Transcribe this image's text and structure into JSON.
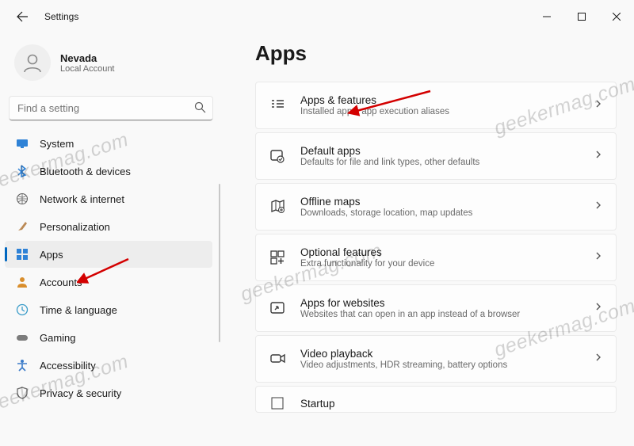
{
  "window": {
    "title": "Settings",
    "user": {
      "name": "Nevada",
      "subtitle": "Local Account"
    },
    "search_placeholder": "Find a setting"
  },
  "nav": {
    "selected_index": 4,
    "items": [
      {
        "label": "System",
        "icon": "display"
      },
      {
        "label": "Bluetooth & devices",
        "icon": "bluetooth"
      },
      {
        "label": "Network & internet",
        "icon": "network"
      },
      {
        "label": "Personalization",
        "icon": "brush"
      },
      {
        "label": "Apps",
        "icon": "apps"
      },
      {
        "label": "Accounts",
        "icon": "person"
      },
      {
        "label": "Time & language",
        "icon": "clock"
      },
      {
        "label": "Gaming",
        "icon": "gaming"
      },
      {
        "label": "Accessibility",
        "icon": "accessibility"
      },
      {
        "label": "Privacy & security",
        "icon": "shield"
      }
    ]
  },
  "page": {
    "title": "Apps",
    "items": [
      {
        "title": "Apps & features",
        "subtitle": "Installed apps, app execution aliases",
        "icon": "list"
      },
      {
        "title": "Default apps",
        "subtitle": "Defaults for file and link types, other defaults",
        "icon": "default"
      },
      {
        "title": "Offline maps",
        "subtitle": "Downloads, storage location, map updates",
        "icon": "map"
      },
      {
        "title": "Optional features",
        "subtitle": "Extra functionality for your device",
        "icon": "optional"
      },
      {
        "title": "Apps for websites",
        "subtitle": "Websites that can open in an app instead of a browser",
        "icon": "openwith"
      },
      {
        "title": "Video playback",
        "subtitle": "Video adjustments, HDR streaming, battery options",
        "icon": "video"
      },
      {
        "title": "Startup",
        "subtitle": "",
        "icon": "startup"
      }
    ]
  },
  "watermark": "geekermag.com"
}
